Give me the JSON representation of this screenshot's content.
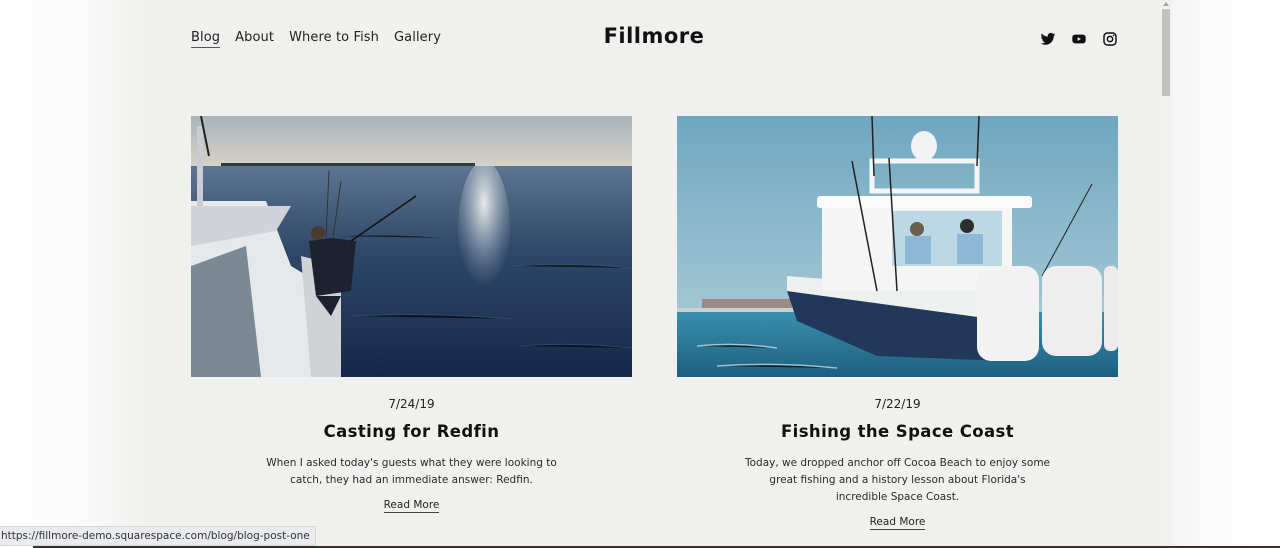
{
  "site": {
    "title": "Fillmore",
    "nav": [
      {
        "label": "Blog",
        "active": true
      },
      {
        "label": "About",
        "active": false
      },
      {
        "label": "Where to Fish",
        "active": false
      },
      {
        "label": "Gallery",
        "active": false
      }
    ],
    "social": [
      {
        "name": "twitter-icon"
      },
      {
        "name": "youtube-icon"
      },
      {
        "name": "instagram-icon"
      }
    ]
  },
  "posts": [
    {
      "date": "7/24/19",
      "title": "Casting for Redfin",
      "excerpt": "When I asked today's guests what they were looking to catch, they had an immediate answer: Redfin.",
      "read_more": "Read More",
      "image": "angler casting from boat bow over open water"
    },
    {
      "date": "7/22/19",
      "title": "Fishing the Space Coast",
      "excerpt": "Today, we dropped anchor off Cocoa Beach to enjoy some great fishing and a history lesson about Florida's incredible Space Coast.",
      "read_more": "Read More",
      "image": "center-console boat with outboard motors at sea"
    }
  ],
  "status_bar": {
    "url": "https://fillmore-demo.squarespace.com/blog/blog-post-one"
  },
  "colors": {
    "page_bg": "#f0f0ee",
    "text": "#111111",
    "water_dark": "#1f3552",
    "sky_blue": "#7fb3c8"
  }
}
